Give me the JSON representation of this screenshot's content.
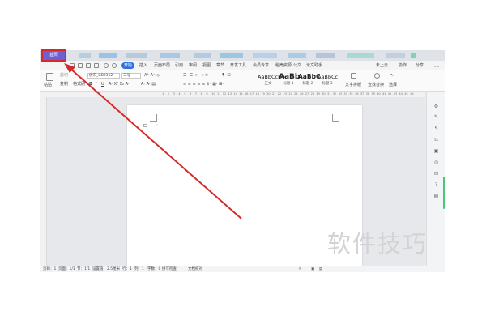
{
  "tabs": {
    "home": "首页"
  },
  "menu": {
    "items": [
      "开始",
      "插入",
      "页面布局",
      "引用",
      "审阅",
      "视图",
      "章节",
      "开发工具",
      "会员专享",
      "稻壳资源",
      "公文",
      "论文助手"
    ],
    "active_index": 0,
    "right": [
      "未上云",
      "协作",
      "分享"
    ]
  },
  "ribbon": {
    "paste": "粘贴",
    "cut": "剪切",
    "copy": "复制",
    "format_painter": "格式刷",
    "font_family": "仿宋_GB2312",
    "font_size": "三号",
    "bold": "B",
    "italic": "I",
    "underline": "U",
    "styles": [
      {
        "sample": "AaBbCcD",
        "name": "正文"
      },
      {
        "sample": "AaBb",
        "name": "标题 1"
      },
      {
        "sample": "AaBbC",
        "name": "标题 2"
      },
      {
        "sample": "AaBbCc",
        "name": "标题 3"
      }
    ],
    "text_layout": "文字排版",
    "find_replace": "查找替换",
    "select": "选择"
  },
  "ruler_numbers": [
    "1",
    "2",
    "3",
    "4",
    "5",
    "6",
    "7",
    "8",
    "9",
    "10",
    "11",
    "12",
    "13",
    "14",
    "15",
    "16",
    "17",
    "18",
    "19",
    "20",
    "21",
    "22",
    "23",
    "24",
    "25",
    "26",
    "27",
    "28",
    "29",
    "30",
    "31",
    "32",
    "33",
    "34",
    "35",
    "36",
    "37",
    "38",
    "39",
    "40",
    "41",
    "42",
    "43",
    "44",
    "45",
    "46"
  ],
  "status": {
    "page": "页码：1",
    "pages": "页面：1/1",
    "section": "节：1/1",
    "position": "设置值：2.5厘米",
    "row": "行：1",
    "col": "列：1",
    "word_count": "字数：0",
    "spell_check": "拼写检查",
    "doc_check": "文档校对"
  },
  "watermark": "软件技巧",
  "colors": {
    "home_tab": "#6f5fd0",
    "active_menu": "#2f6fe4",
    "highlight": "#d62a2a"
  }
}
